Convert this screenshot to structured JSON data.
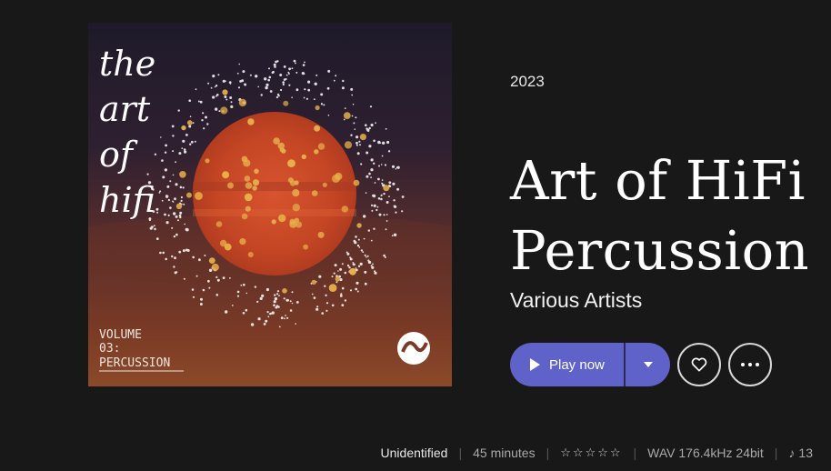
{
  "album": {
    "year": "2023",
    "title_line1": "Art of HiFi",
    "title_line2": "Percussion",
    "artist": "Various Artists",
    "cover": {
      "logo_lines": [
        "the",
        "art",
        "of",
        "hifi"
      ],
      "volume_line1": "VOLUME",
      "volume_line2": "03:",
      "volume_line3": "PERCUSSION"
    }
  },
  "actions": {
    "play_label": "Play now",
    "play_icon": "play-icon",
    "dropdown_icon": "caret-down-icon",
    "favorite_icon": "heart-icon",
    "more_icon": "more-dots-icon"
  },
  "meta": {
    "status": "Unidentified",
    "duration": "45 minutes",
    "rating": "☆☆☆☆☆",
    "format": "WAV 176.4kHz 24bit",
    "tracks_prefix": "♪",
    "track_count": "13"
  },
  "colors": {
    "background": "#181818",
    "accent": "#5f62c9"
  }
}
